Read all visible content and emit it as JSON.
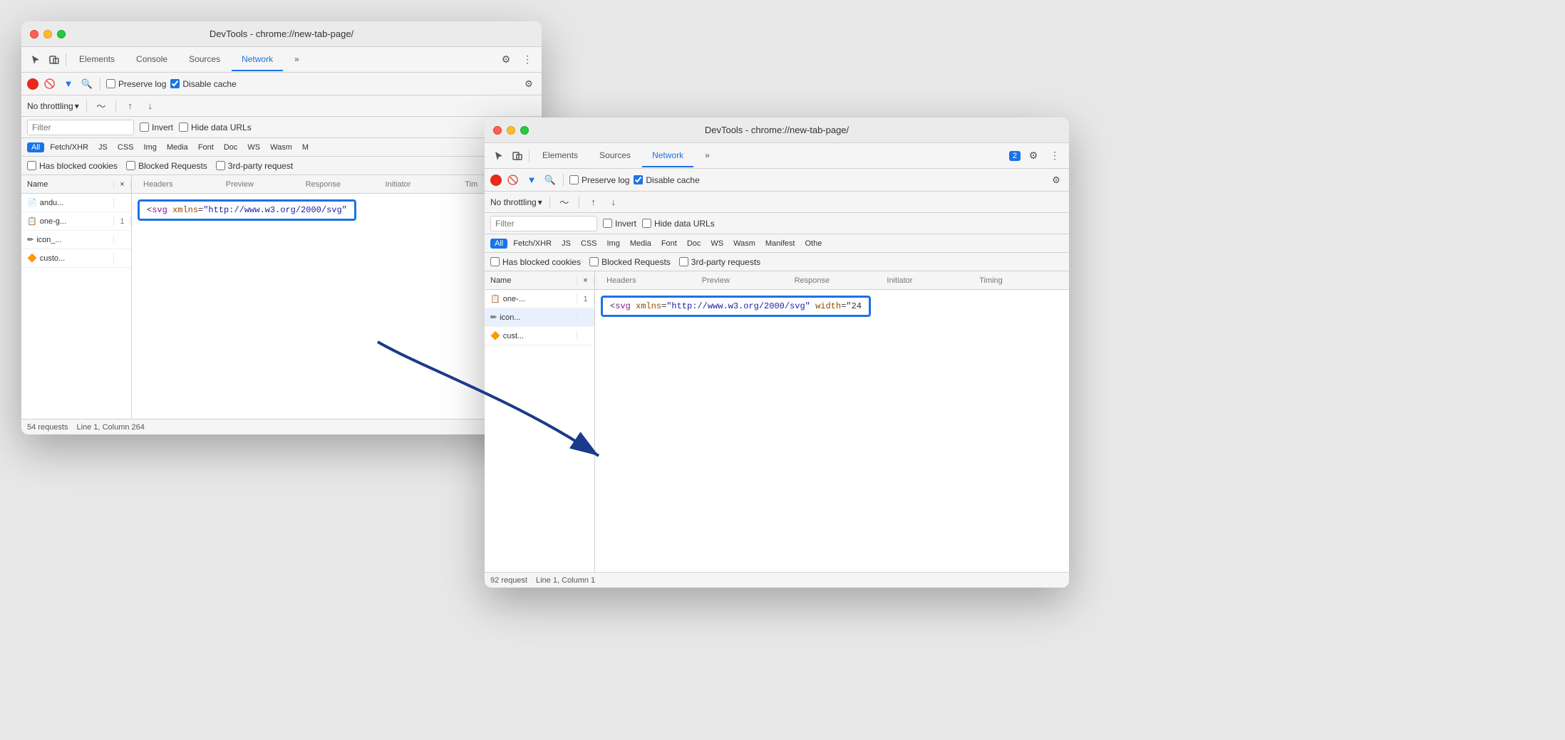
{
  "window1": {
    "title": "DevTools - chrome://new-tab-page/",
    "tabs": [
      "Elements",
      "Console",
      "Sources",
      "Network",
      "»"
    ],
    "active_tab": "Network",
    "record_btn": "●",
    "toolbar_items": [
      "🔴",
      "🚫",
      "▼",
      "🔍"
    ],
    "preserve_log": "Preserve log",
    "disable_cache": "Disable cache",
    "throttle": "No throttling",
    "filter_placeholder": "Filter",
    "invert": "Invert",
    "hide_data": "Hide data URLs",
    "type_filters": [
      "All",
      "Fetch/XHR",
      "JS",
      "CSS",
      "Img",
      "Media",
      "Font",
      "Doc",
      "WS",
      "Wasm",
      "M"
    ],
    "active_type": "All",
    "has_blocked": "Has blocked cookies",
    "blocked_req": "Blocked Requests",
    "third_party": "3rd-party request",
    "col_name": "Name",
    "col_x": "×",
    "col_headers": [
      "Headers",
      "Preview",
      "Response",
      "Initiator",
      "Tim"
    ],
    "rows": [
      {
        "icon": "📄",
        "name": "andu...",
        "x": "",
        "active": false
      },
      {
        "icon": "📋",
        "name": "one-g...",
        "x": "1",
        "active": false
      },
      {
        "icon": "✏️",
        "name": "icon_...",
        "x": "",
        "active": false
      },
      {
        "icon": "🔶",
        "name": "custo...",
        "x": "",
        "active": false
      }
    ],
    "preview_text": "<svg xmlns=\"http://www.w3.org/2000/svg\"",
    "status_requests": "54 requests",
    "status_position": "Line 1, Column 264"
  },
  "window2": {
    "title": "DevTools - chrome://new-tab-page/",
    "tabs": [
      "Elements",
      "Sources",
      "Network",
      "»"
    ],
    "active_tab": "Network",
    "badge_count": "2",
    "preserve_log": "Preserve log",
    "disable_cache": "Disable cache",
    "throttle": "No throttling",
    "filter_placeholder": "Filter",
    "invert": "Invert",
    "hide_data": "Hide data URLs",
    "type_filters": [
      "All",
      "Fetch/XHR",
      "JS",
      "CSS",
      "Img",
      "Media",
      "Font",
      "Doc",
      "WS",
      "Wasm",
      "Manifest",
      "Othe"
    ],
    "active_type": "All",
    "has_blocked": "Has blocked cookies",
    "blocked_req": "Blocked Requests",
    "third_party": "3rd-party requests",
    "col_name": "Name",
    "col_x": "×",
    "col_headers": [
      "Headers",
      "Preview",
      "Response",
      "Initiator",
      "Timing"
    ],
    "rows": [
      {
        "icon": "📋",
        "name": "one-...",
        "x": "1",
        "active": false
      },
      {
        "icon": "✏️",
        "name": "icon...",
        "x": "",
        "active": true
      },
      {
        "icon": "🔶",
        "name": "cust...",
        "x": "",
        "active": false
      }
    ],
    "preview_text_start": "<svg xmlns=",
    "preview_text_url": "\"http://www.w3.org/2000/svg\"",
    "preview_text_attr": " width=\"24",
    "status_requests": "92 request",
    "status_position": "Line 1, Column 1"
  },
  "icons": {
    "cursor": "⬡",
    "layers": "⧉",
    "gear": "⚙",
    "more": "⋮",
    "record": "●",
    "stop": "⊘",
    "funnel": "▼",
    "search": "🔍",
    "upload": "↑",
    "download": "↓",
    "wifi": "〜",
    "chevron": "▾"
  }
}
